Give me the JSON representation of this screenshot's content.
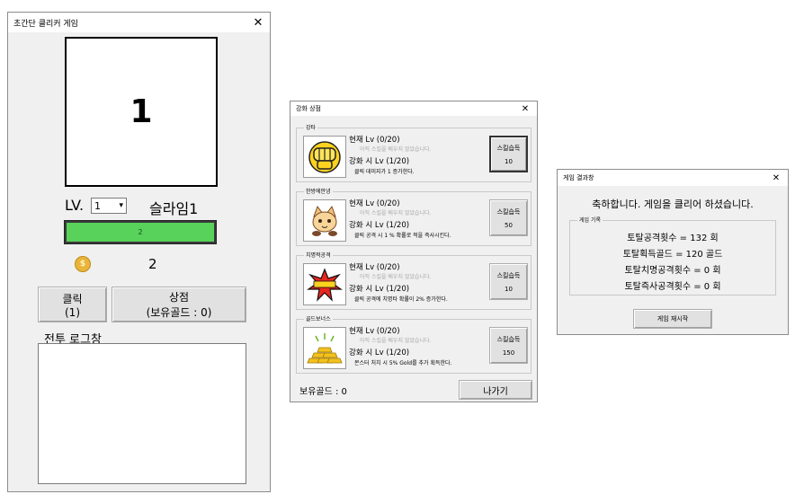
{
  "main_window": {
    "title": "초간단 클리커 게임",
    "close": "✕",
    "monster_display": "1",
    "lv_label": "LV.",
    "lv_value": "1",
    "dropdown_arrow": "▾",
    "monster_name": "슬라임1",
    "hp_text": "2",
    "hp_fraction": 1.0,
    "gold_amount": "2",
    "click_button": {
      "line1": "클릭",
      "line2": "(1)"
    },
    "shop_button": {
      "line1": "상점",
      "line2": "(보유골드 : 0)"
    },
    "log_label": "전투 로그창"
  },
  "shop_window": {
    "title": "강화 상점",
    "close": "✕",
    "skills": [
      {
        "group": "강타",
        "icon": "fist-icon",
        "current": "현재 Lv (0/20)",
        "hint": "아직 스킬을 배우지 않았습니다.",
        "next": "강화 시 Lv (1/20)",
        "desc": "클릭 데미지가 1 증가한다.",
        "button": "스킬습득",
        "cost": "10"
      },
      {
        "group": "한방에안녕",
        "icon": "cat-icon",
        "current": "현재 Lv (0/20)",
        "hint": "아직 스킬을 배우지 않았습니다.",
        "next": "강화 시 Lv (1/20)",
        "desc": "클릭 공격 시 1 % 확률로 적을 즉사시킨다.",
        "button": "스킬습득",
        "cost": "50"
      },
      {
        "group": "치명적공격",
        "icon": "critical-hit-icon",
        "current": "현재 Lv (0/20)",
        "hint": "아직 스킬을 배우지 않았습니다.",
        "next": "강화 시 Lv (1/20)",
        "desc": "클릭 공격에 치명타 확률이 2% 증가한다.",
        "button": "스킬습득",
        "cost": "10"
      },
      {
        "group": "골드보너스",
        "icon": "gold-bars-icon",
        "current": "현재 Lv (0/20)",
        "hint": "아직 스킬을 배우지 않았습니다.",
        "next": "강화 시 Lv (1/20)",
        "desc": "몬스터 처치 시 5% Gold를 추가 획득한다.",
        "button": "스킬습득",
        "cost": "150"
      }
    ],
    "gold_label": "보유골드 : 0",
    "exit_button": "나가기"
  },
  "result_window": {
    "title": "게임 결과창",
    "close": "✕",
    "congrats": "축하합니다. 게임을 클리어 하셨습니다.",
    "group_label": "게임 기록",
    "stats": [
      "토탈공격횟수 = 132 회",
      "토탈획득골드 = 120 골드",
      "토탈치명공격횟수 = 0 회",
      "토탈즉사공격횟수 = 0 회"
    ],
    "restart_button": "게임 재시작"
  },
  "colors": {
    "window_bg": "#f0f0f0",
    "hp_green": "#58d25a",
    "coin_gold": "#e8b43a"
  }
}
